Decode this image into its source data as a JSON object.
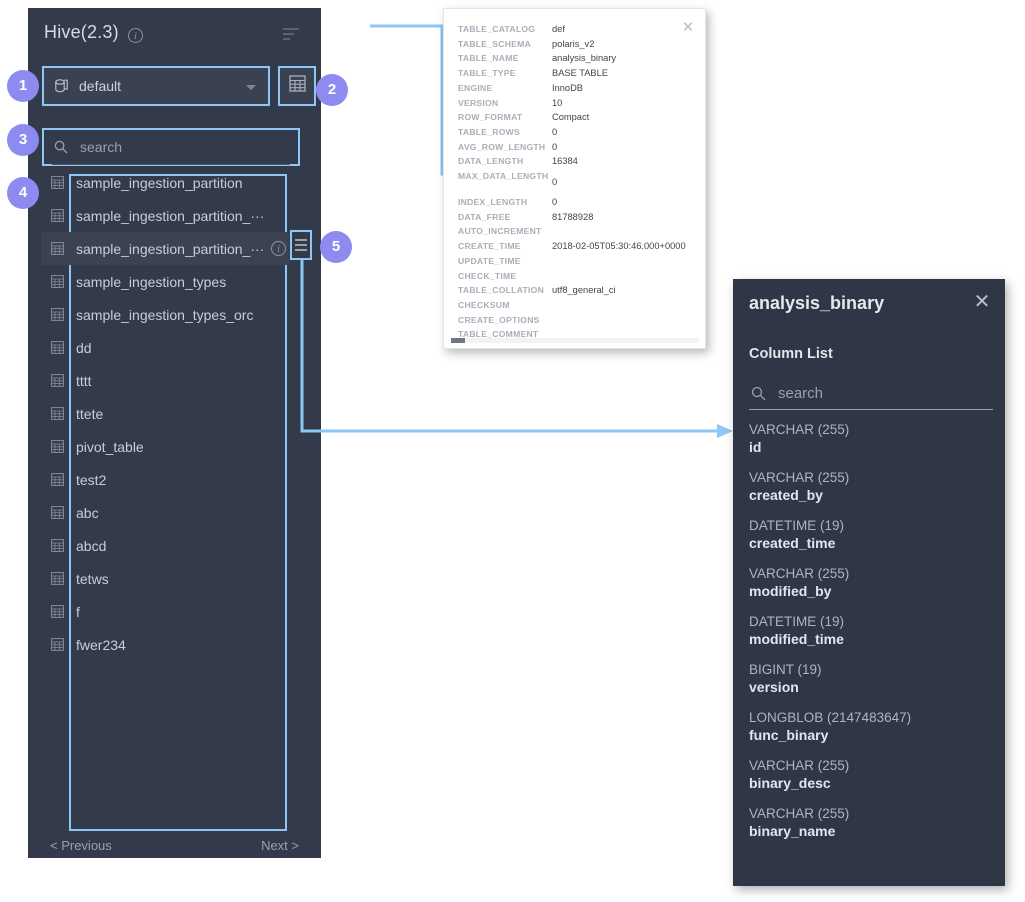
{
  "explorer": {
    "title": "Hive(2.3)",
    "info_icon": "info-icon",
    "filter_icon": "filter-list-icon",
    "database_select": {
      "value": "default",
      "icon": "database-icon",
      "caret": "chevron-down-icon"
    },
    "grid_button_icon": "table-grid-icon",
    "search": {
      "placeholder": "search",
      "icon": "search-icon"
    },
    "tables": [
      {
        "name": "sample_ingestion_partition",
        "hovered": false
      },
      {
        "name": "sample_ingestion_partition_···",
        "hovered": false
      },
      {
        "name": "sample_ingestion_partition_···",
        "hovered": true
      },
      {
        "name": "sample_ingestion_types",
        "hovered": false
      },
      {
        "name": "sample_ingestion_types_orc",
        "hovered": false
      },
      {
        "name": "dd",
        "hovered": false
      },
      {
        "name": "tttt",
        "hovered": false
      },
      {
        "name": "ttete",
        "hovered": false
      },
      {
        "name": "pivot_table",
        "hovered": false
      },
      {
        "name": "test2",
        "hovered": false
      },
      {
        "name": "abc",
        "hovered": false
      },
      {
        "name": "abcd",
        "hovered": false
      },
      {
        "name": "tetws",
        "hovered": false
      },
      {
        "name": "f",
        "hovered": false
      },
      {
        "name": "fwer234",
        "hovered": false
      }
    ],
    "row_actions": {
      "info_icon": "info-icon",
      "menu_icon": "hamburger-menu-icon"
    },
    "pager": {
      "previous": "< Previous",
      "next": "Next >"
    }
  },
  "meta_popup": {
    "close_icon": "close-icon",
    "rows": [
      {
        "key": "TABLE_CATALOG",
        "value": "def"
      },
      {
        "key": "TABLE_SCHEMA",
        "value": "polaris_v2"
      },
      {
        "key": "TABLE_NAME",
        "value": "analysis_binary"
      },
      {
        "key": "TABLE_TYPE",
        "value": "BASE TABLE"
      },
      {
        "key": "ENGINE",
        "value": "InnoDB"
      },
      {
        "key": "VERSION",
        "value": "10"
      },
      {
        "key": "ROW_FORMAT",
        "value": "Compact"
      },
      {
        "key": "TABLE_ROWS",
        "value": "0"
      },
      {
        "key": "AVG_ROW_LENGTH",
        "value": "0"
      },
      {
        "key": "DATA_LENGTH",
        "value": "16384"
      },
      {
        "key": "MAX_DATA_LENGTH",
        "value": "0",
        "two_line": true
      },
      {
        "key": "INDEX_LENGTH",
        "value": "0"
      },
      {
        "key": "DATA_FREE",
        "value": "81788928"
      },
      {
        "key": "AUTO_INCREMENT",
        "value": ""
      },
      {
        "key": "CREATE_TIME",
        "value": "2018-02-05T05:30:46.000+0000"
      },
      {
        "key": "UPDATE_TIME",
        "value": ""
      },
      {
        "key": "CHECK_TIME",
        "value": ""
      },
      {
        "key": "TABLE_COLLATION",
        "value": "utf8_general_ci"
      },
      {
        "key": "CHECKSUM",
        "value": ""
      },
      {
        "key": "CREATE_OPTIONS",
        "value": ""
      },
      {
        "key": "TABLE_COMMENT",
        "value": ""
      }
    ]
  },
  "column_panel": {
    "title": "analysis_binary",
    "close_icon": "close-icon",
    "subtitle": "Column List",
    "search": {
      "placeholder": "search",
      "icon": "search-icon"
    },
    "columns": [
      {
        "type": "VARCHAR (255)",
        "name": "id"
      },
      {
        "type": "VARCHAR (255)",
        "name": "created_by"
      },
      {
        "type": "DATETIME (19)",
        "name": "created_time"
      },
      {
        "type": "VARCHAR (255)",
        "name": "modified_by"
      },
      {
        "type": "DATETIME (19)",
        "name": "modified_time"
      },
      {
        "type": "BIGINT (19)",
        "name": "version"
      },
      {
        "type": "LONGBLOB (2147483647)",
        "name": "func_binary"
      },
      {
        "type": "VARCHAR (255)",
        "name": "binary_desc"
      },
      {
        "type": "VARCHAR (255)",
        "name": "binary_name"
      }
    ]
  },
  "annotations": {
    "badges": [
      {
        "number": "1",
        "target": "database-select"
      },
      {
        "number": "2",
        "target": "grid-button"
      },
      {
        "number": "3",
        "target": "search-input"
      },
      {
        "number": "4",
        "target": "table-list"
      },
      {
        "number": "5",
        "target": "row-menu-button"
      }
    ],
    "accent_color": "#8ec6f5",
    "badge_color": "#8d8bf0"
  }
}
